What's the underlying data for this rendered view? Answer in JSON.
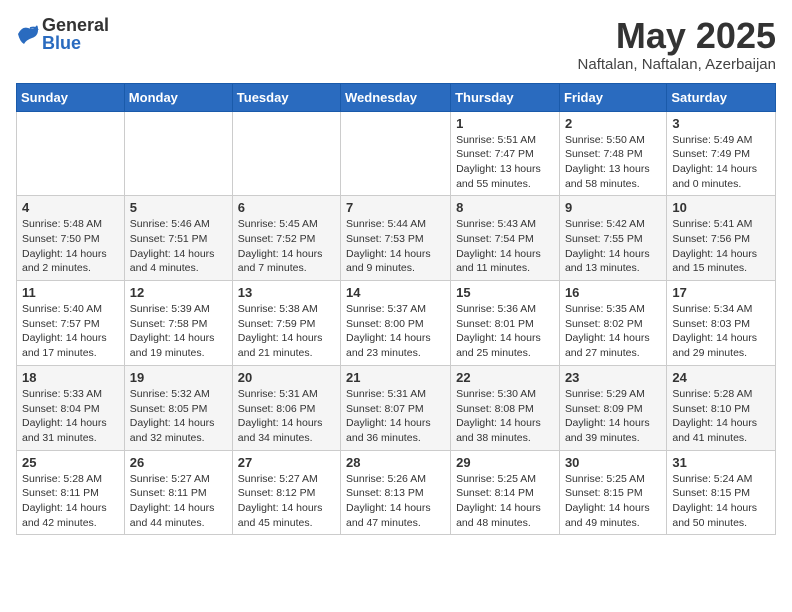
{
  "logo": {
    "general": "General",
    "blue": "Blue"
  },
  "title": {
    "month": "May 2025",
    "location": "Naftalan, Naftalan, Azerbaijan"
  },
  "headers": [
    "Sunday",
    "Monday",
    "Tuesday",
    "Wednesday",
    "Thursday",
    "Friday",
    "Saturday"
  ],
  "weeks": [
    [
      {
        "day": "",
        "info": ""
      },
      {
        "day": "",
        "info": ""
      },
      {
        "day": "",
        "info": ""
      },
      {
        "day": "",
        "info": ""
      },
      {
        "day": "1",
        "info": "Sunrise: 5:51 AM\nSunset: 7:47 PM\nDaylight: 13 hours\nand 55 minutes."
      },
      {
        "day": "2",
        "info": "Sunrise: 5:50 AM\nSunset: 7:48 PM\nDaylight: 13 hours\nand 58 minutes."
      },
      {
        "day": "3",
        "info": "Sunrise: 5:49 AM\nSunset: 7:49 PM\nDaylight: 14 hours\nand 0 minutes."
      }
    ],
    [
      {
        "day": "4",
        "info": "Sunrise: 5:48 AM\nSunset: 7:50 PM\nDaylight: 14 hours\nand 2 minutes."
      },
      {
        "day": "5",
        "info": "Sunrise: 5:46 AM\nSunset: 7:51 PM\nDaylight: 14 hours\nand 4 minutes."
      },
      {
        "day": "6",
        "info": "Sunrise: 5:45 AM\nSunset: 7:52 PM\nDaylight: 14 hours\nand 7 minutes."
      },
      {
        "day": "7",
        "info": "Sunrise: 5:44 AM\nSunset: 7:53 PM\nDaylight: 14 hours\nand 9 minutes."
      },
      {
        "day": "8",
        "info": "Sunrise: 5:43 AM\nSunset: 7:54 PM\nDaylight: 14 hours\nand 11 minutes."
      },
      {
        "day": "9",
        "info": "Sunrise: 5:42 AM\nSunset: 7:55 PM\nDaylight: 14 hours\nand 13 minutes."
      },
      {
        "day": "10",
        "info": "Sunrise: 5:41 AM\nSunset: 7:56 PM\nDaylight: 14 hours\nand 15 minutes."
      }
    ],
    [
      {
        "day": "11",
        "info": "Sunrise: 5:40 AM\nSunset: 7:57 PM\nDaylight: 14 hours\nand 17 minutes."
      },
      {
        "day": "12",
        "info": "Sunrise: 5:39 AM\nSunset: 7:58 PM\nDaylight: 14 hours\nand 19 minutes."
      },
      {
        "day": "13",
        "info": "Sunrise: 5:38 AM\nSunset: 7:59 PM\nDaylight: 14 hours\nand 21 minutes."
      },
      {
        "day": "14",
        "info": "Sunrise: 5:37 AM\nSunset: 8:00 PM\nDaylight: 14 hours\nand 23 minutes."
      },
      {
        "day": "15",
        "info": "Sunrise: 5:36 AM\nSunset: 8:01 PM\nDaylight: 14 hours\nand 25 minutes."
      },
      {
        "day": "16",
        "info": "Sunrise: 5:35 AM\nSunset: 8:02 PM\nDaylight: 14 hours\nand 27 minutes."
      },
      {
        "day": "17",
        "info": "Sunrise: 5:34 AM\nSunset: 8:03 PM\nDaylight: 14 hours\nand 29 minutes."
      }
    ],
    [
      {
        "day": "18",
        "info": "Sunrise: 5:33 AM\nSunset: 8:04 PM\nDaylight: 14 hours\nand 31 minutes."
      },
      {
        "day": "19",
        "info": "Sunrise: 5:32 AM\nSunset: 8:05 PM\nDaylight: 14 hours\nand 32 minutes."
      },
      {
        "day": "20",
        "info": "Sunrise: 5:31 AM\nSunset: 8:06 PM\nDaylight: 14 hours\nand 34 minutes."
      },
      {
        "day": "21",
        "info": "Sunrise: 5:31 AM\nSunset: 8:07 PM\nDaylight: 14 hours\nand 36 minutes."
      },
      {
        "day": "22",
        "info": "Sunrise: 5:30 AM\nSunset: 8:08 PM\nDaylight: 14 hours\nand 38 minutes."
      },
      {
        "day": "23",
        "info": "Sunrise: 5:29 AM\nSunset: 8:09 PM\nDaylight: 14 hours\nand 39 minutes."
      },
      {
        "day": "24",
        "info": "Sunrise: 5:28 AM\nSunset: 8:10 PM\nDaylight: 14 hours\nand 41 minutes."
      }
    ],
    [
      {
        "day": "25",
        "info": "Sunrise: 5:28 AM\nSunset: 8:11 PM\nDaylight: 14 hours\nand 42 minutes."
      },
      {
        "day": "26",
        "info": "Sunrise: 5:27 AM\nSunset: 8:11 PM\nDaylight: 14 hours\nand 44 minutes."
      },
      {
        "day": "27",
        "info": "Sunrise: 5:27 AM\nSunset: 8:12 PM\nDaylight: 14 hours\nand 45 minutes."
      },
      {
        "day": "28",
        "info": "Sunrise: 5:26 AM\nSunset: 8:13 PM\nDaylight: 14 hours\nand 47 minutes."
      },
      {
        "day": "29",
        "info": "Sunrise: 5:25 AM\nSunset: 8:14 PM\nDaylight: 14 hours\nand 48 minutes."
      },
      {
        "day": "30",
        "info": "Sunrise: 5:25 AM\nSunset: 8:15 PM\nDaylight: 14 hours\nand 49 minutes."
      },
      {
        "day": "31",
        "info": "Sunrise: 5:24 AM\nSunset: 8:15 PM\nDaylight: 14 hours\nand 50 minutes."
      }
    ]
  ]
}
